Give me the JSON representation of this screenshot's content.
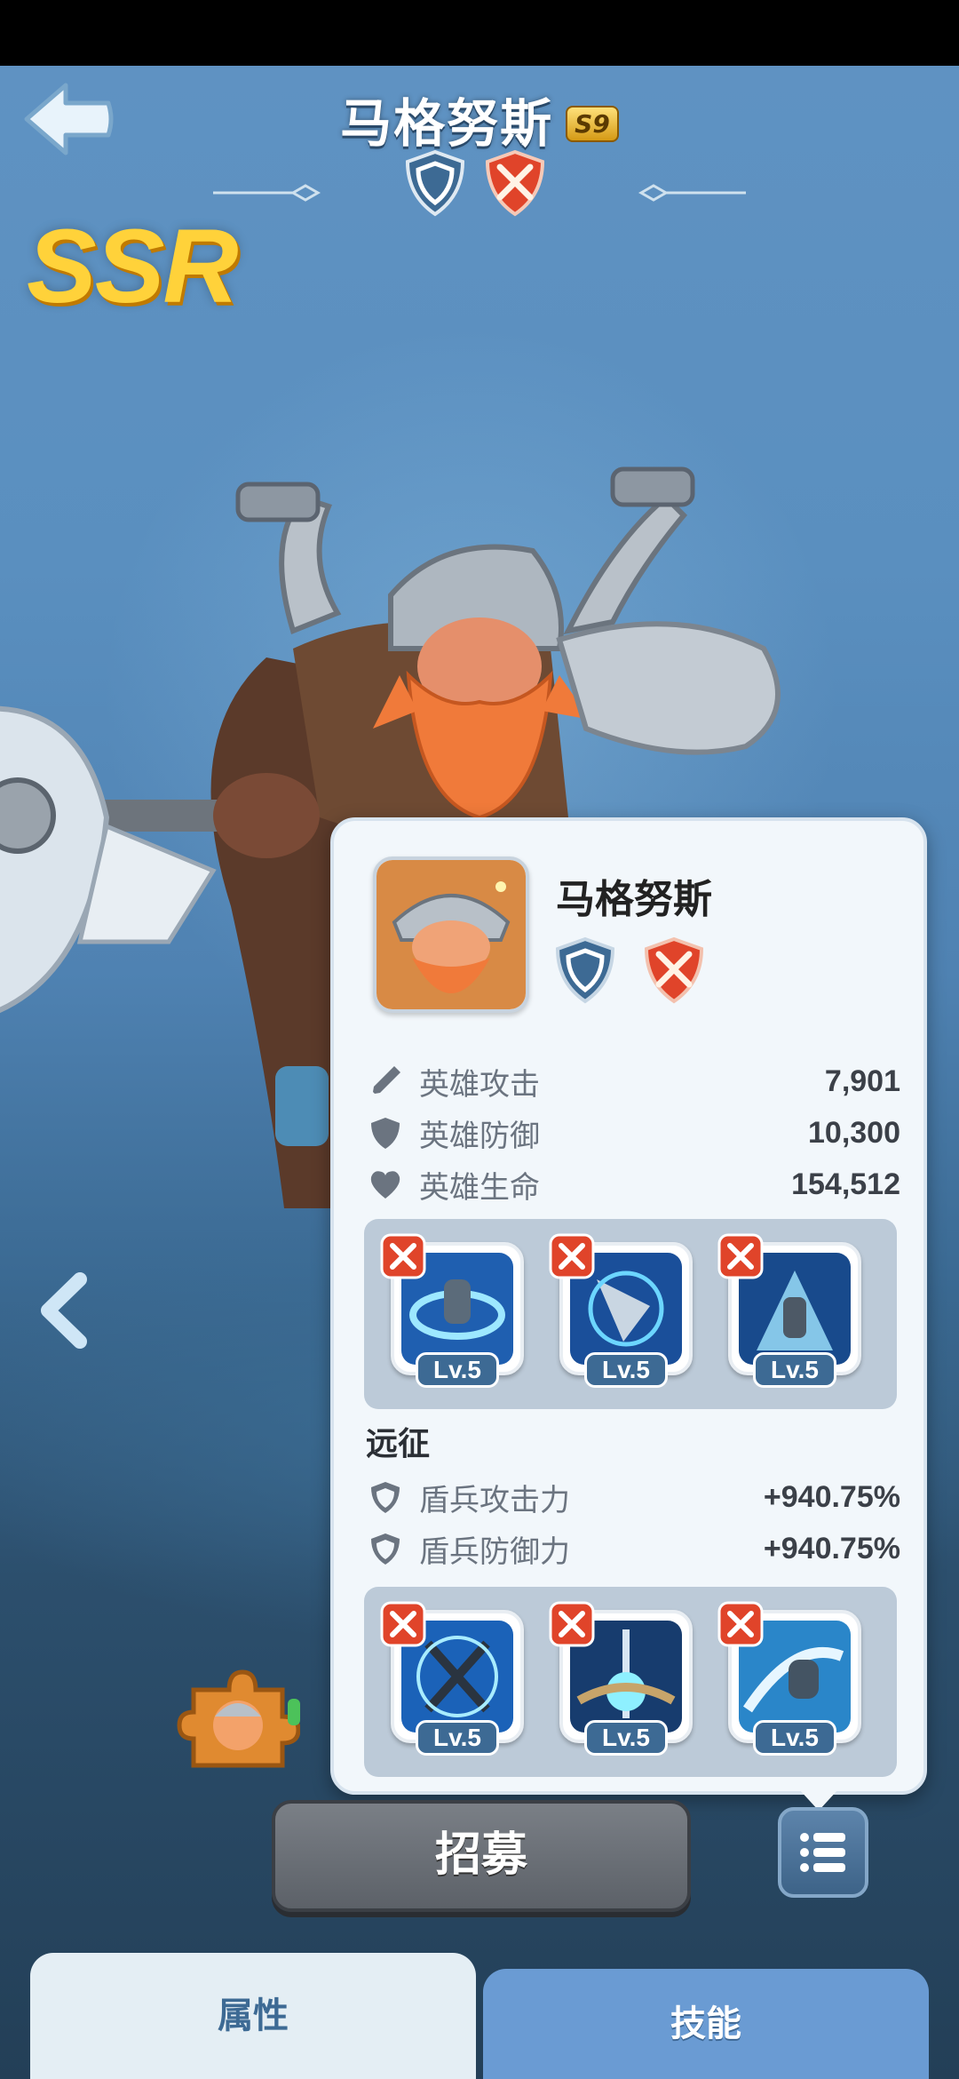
{
  "header": {
    "title": "马格努斯",
    "season_badge": "S9"
  },
  "rarity": "SSR",
  "panel": {
    "name": "马格努斯",
    "stats": [
      {
        "icon": "sword-icon",
        "label": "英雄攻击",
        "value": "7,901"
      },
      {
        "icon": "shield-icon",
        "label": "英雄防御",
        "value": "10,300"
      },
      {
        "icon": "heart-icon",
        "label": "英雄生命",
        "value": "154,512"
      }
    ],
    "skills_top": [
      {
        "level": "Lv.5"
      },
      {
        "level": "Lv.5"
      },
      {
        "level": "Lv.5"
      }
    ],
    "expedition": {
      "title": "远征",
      "stats": [
        {
          "icon": "shield-icon",
          "label": "盾兵攻击力",
          "value": "+940.75%"
        },
        {
          "icon": "shield-icon",
          "label": "盾兵防御力",
          "value": "+940.75%"
        }
      ]
    },
    "skills_bottom": [
      {
        "level": "Lv.5"
      },
      {
        "level": "Lv.5"
      },
      {
        "level": "Lv.5"
      }
    ]
  },
  "buttons": {
    "recruit": "招募"
  },
  "tabs": {
    "attributes": "属性",
    "skills": "技能"
  },
  "colors": {
    "accent_blue": "#3d6a94",
    "ssr_gold": "#ffd23a",
    "class_red": "#e0442a"
  }
}
